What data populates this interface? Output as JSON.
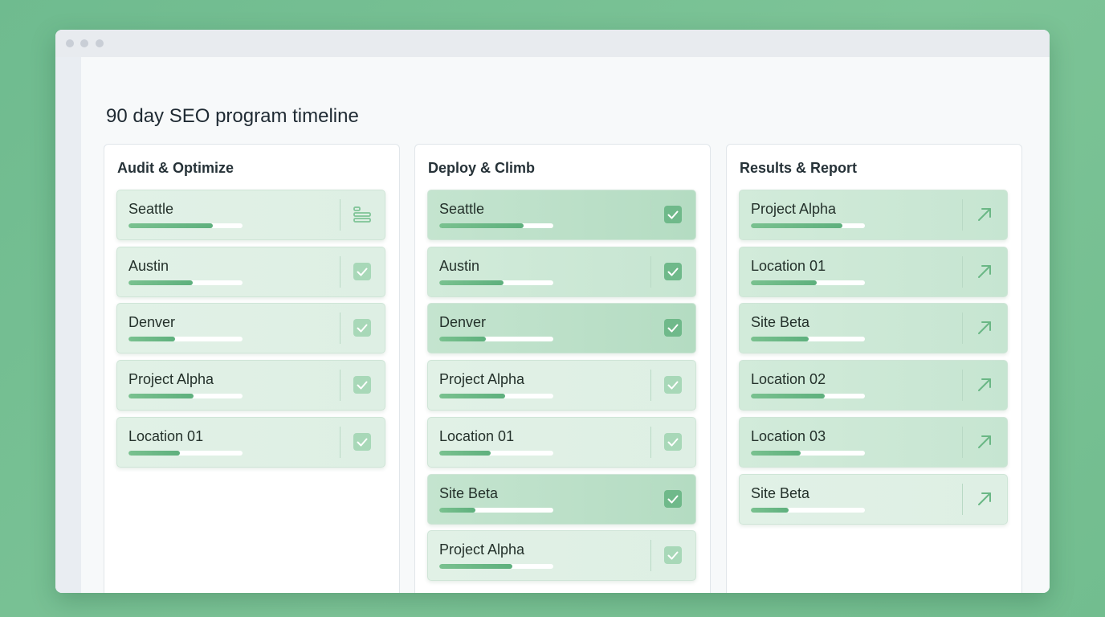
{
  "page_title": "90 day SEO program timeline",
  "colors": {
    "background": "#76c093",
    "accent": "#5eb07d",
    "card_light": "#e1f1e6",
    "card_dark": "#b4dcc2"
  },
  "columns": [
    {
      "title": "Audit & Optimize",
      "cards": [
        {
          "label": "Seattle",
          "progress": 0.74,
          "icon": "list-bars-icon",
          "shade": "light"
        },
        {
          "label": "Austin",
          "progress": 0.56,
          "icon": "check-icon",
          "shade": "light"
        },
        {
          "label": "Denver",
          "progress": 0.41,
          "icon": "check-icon",
          "shade": "light"
        },
        {
          "label": "Project Alpha",
          "progress": 0.57,
          "icon": "check-icon",
          "shade": "light"
        },
        {
          "label": "Location 01",
          "progress": 0.45,
          "icon": "check-icon",
          "shade": "light"
        }
      ]
    },
    {
      "title": "Deploy & Climb",
      "cards": [
        {
          "label": "Seattle",
          "progress": 0.74,
          "icon": "check-icon",
          "shade": "dark"
        },
        {
          "label": "Austin",
          "progress": 0.56,
          "icon": "check-icon",
          "shade": "mid"
        },
        {
          "label": "Denver",
          "progress": 0.41,
          "icon": "check-icon",
          "shade": "dark"
        },
        {
          "label": "Project Alpha",
          "progress": 0.58,
          "icon": "check-icon",
          "shade": "light"
        },
        {
          "label": "Location 01",
          "progress": 0.45,
          "icon": "check-icon",
          "shade": "light"
        },
        {
          "label": "Site Beta",
          "progress": 0.32,
          "icon": "check-icon",
          "shade": "dark"
        },
        {
          "label": "Project Alpha",
          "progress": 0.64,
          "icon": "check-icon",
          "shade": "light"
        }
      ]
    },
    {
      "title": "Results & Report",
      "cards": [
        {
          "label": "Project Alpha",
          "progress": 0.8,
          "icon": "arrow-up-right-icon",
          "shade": "mid"
        },
        {
          "label": "Location 01",
          "progress": 0.58,
          "icon": "arrow-up-right-icon",
          "shade": "mid"
        },
        {
          "label": "Site Beta",
          "progress": 0.51,
          "icon": "arrow-up-right-icon",
          "shade": "mid"
        },
        {
          "label": "Location 02",
          "progress": 0.65,
          "icon": "arrow-up-right-icon",
          "shade": "mid"
        },
        {
          "label": "Location 03",
          "progress": 0.44,
          "icon": "arrow-up-right-icon",
          "shade": "mid"
        },
        {
          "label": "Site Beta",
          "progress": 0.33,
          "icon": "arrow-up-right-icon",
          "shade": "light"
        }
      ]
    }
  ]
}
